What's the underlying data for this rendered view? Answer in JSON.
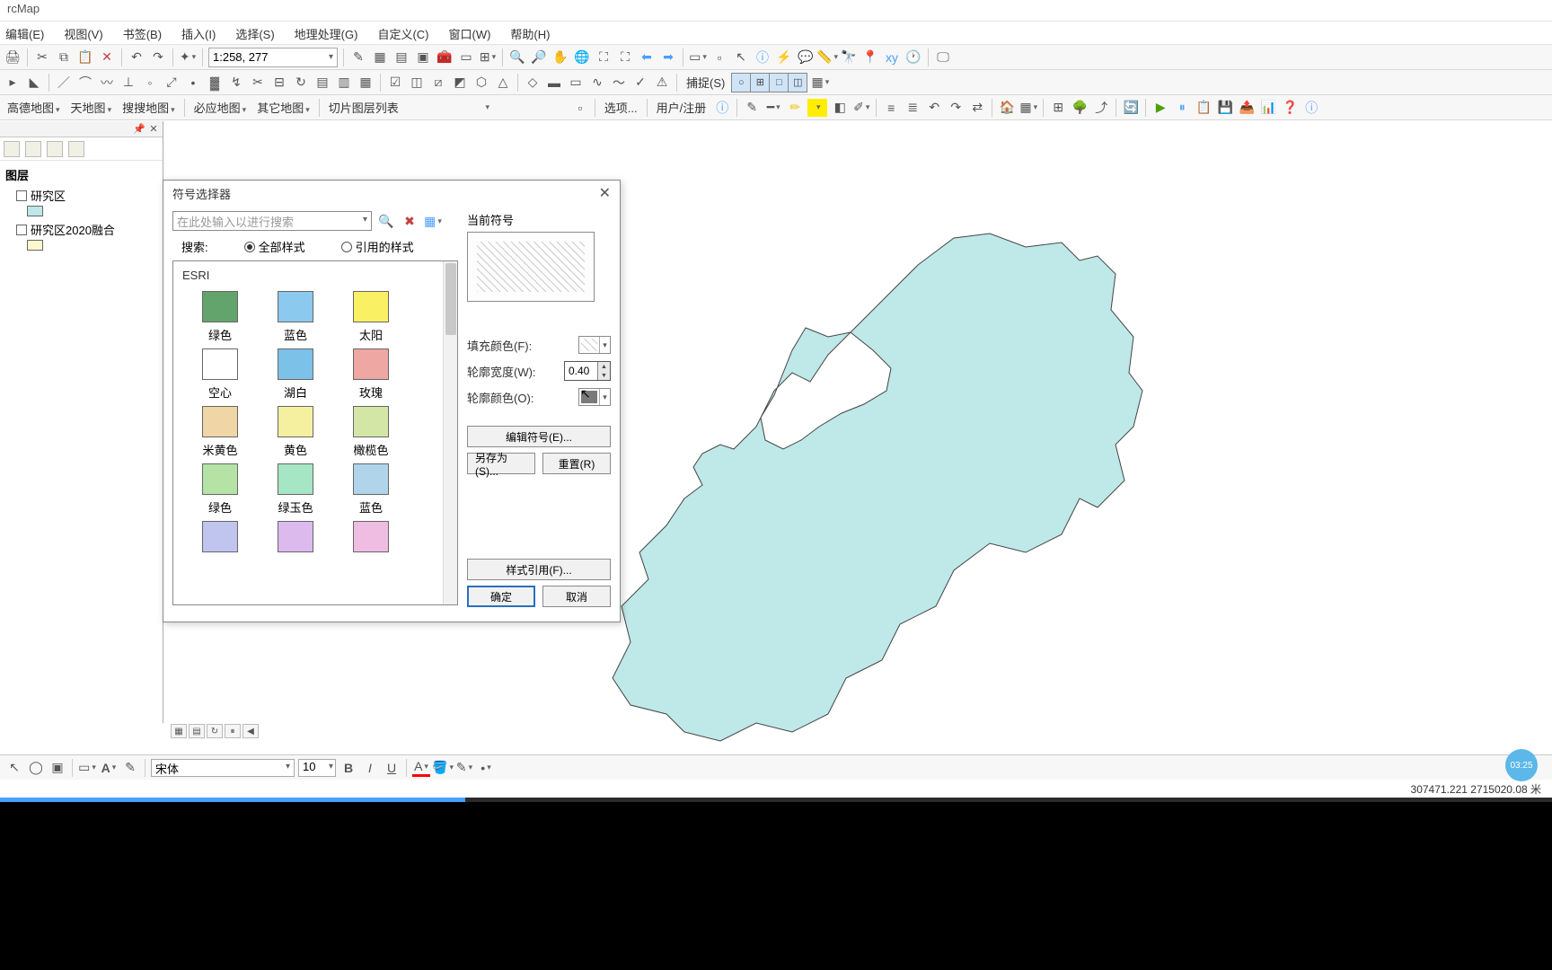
{
  "app": {
    "title": "rcMap"
  },
  "menu": [
    "编辑(E)",
    "视图(V)",
    "书签(B)",
    "插入(I)",
    "选择(S)",
    "地理处理(G)",
    "自定义(C)",
    "窗口(W)",
    "帮助(H)"
  ],
  "toolbar1": {
    "scale": "1:258, 277"
  },
  "toolbar3": {
    "maps": [
      "高德地图",
      "天地图",
      "搜搜地图"
    ],
    "maps2": [
      "必应地图",
      "其它地图"
    ],
    "tiles": "切片图层列表",
    "select": "选项...",
    "user": "用户/注册"
  },
  "snap_label": "捕捉(S)",
  "toc": {
    "root": "图层",
    "layers": [
      {
        "name": "研究区",
        "swatch": "cyan"
      },
      {
        "name": "研究区2020融合",
        "swatch": "yellow"
      }
    ]
  },
  "text_tb": {
    "font": "宋体",
    "size": "10"
  },
  "status": {
    "coords": "307471.221  2715020.08 米"
  },
  "dialog": {
    "title": "符号选择器",
    "search_placeholder": "在此处输入以进行搜索",
    "search_label": "搜索:",
    "radio_all": "全部样式",
    "radio_ref": "引用的样式",
    "category": "ESRI",
    "swatches": [
      {
        "label": "绿色",
        "color": "#62a46b"
      },
      {
        "label": "蓝色",
        "color": "#8cc9ee"
      },
      {
        "label": "太阳",
        "color": "#faf064"
      },
      {
        "label": "空心",
        "color": "#ffffff"
      },
      {
        "label": "湖白",
        "color": "#7cc1e8"
      },
      {
        "label": "玫瑰",
        "color": "#eea7a3"
      },
      {
        "label": "米黄色",
        "color": "#f0d6a6"
      },
      {
        "label": "黄色",
        "color": "#f5f0a0"
      },
      {
        "label": "橄榄色",
        "color": "#d4e6a6"
      },
      {
        "label": "绿色",
        "color": "#b5e3a6"
      },
      {
        "label": "绿玉色",
        "color": "#a6e6c4"
      },
      {
        "label": "蓝色",
        "color": "#b0d5ea"
      },
      {
        "label": "",
        "color": "#c0c5ef"
      },
      {
        "label": "",
        "color": "#dcbaee"
      },
      {
        "label": "",
        "color": "#f0bde2"
      }
    ],
    "preview_label": "当前符号",
    "fill_label": "填充颜色(F):",
    "width_label": "轮廓宽度(W):",
    "width_value": "0.40",
    "outline_label": "轮廓颜色(O):",
    "edit_btn": "编辑符号(E)...",
    "saveas_btn": "另存为(S)...",
    "reset_btn": "重置(R)",
    "styleref_btn": "样式引用(F)...",
    "ok_btn": "确定",
    "cancel_btn": "取消"
  },
  "video": {
    "time": "03:25"
  }
}
